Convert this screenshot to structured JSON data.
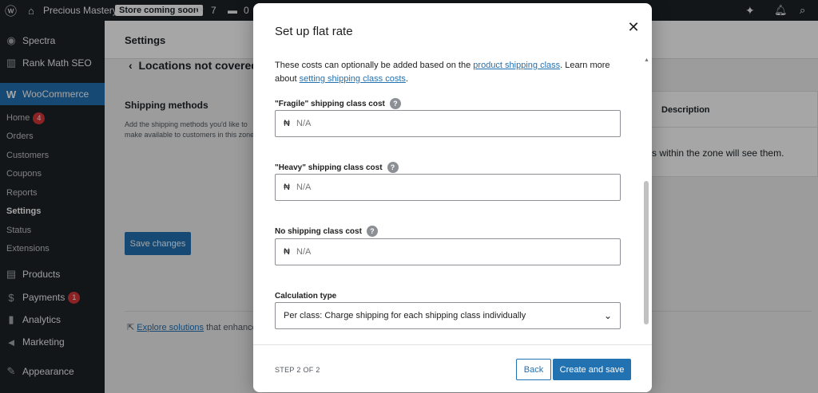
{
  "adminbar": {
    "site_name": "Precious Mastery",
    "store_badge": "Store coming soon",
    "updates_count": "7",
    "comments_count": "0"
  },
  "sidebar": {
    "items": [
      {
        "label": "Spectra",
        "icon": "spectra-icon"
      },
      {
        "label": "Rank Math SEO",
        "icon": "rank-math-icon"
      },
      {
        "label": "WooCommerce",
        "icon": "woocommerce-icon"
      },
      {
        "label": "Products",
        "icon": "products-icon"
      },
      {
        "label": "Payments",
        "icon": "payments-icon",
        "badge": "1"
      },
      {
        "label": "Analytics",
        "icon": "analytics-icon"
      },
      {
        "label": "Marketing",
        "icon": "marketing-icon"
      },
      {
        "label": "Appearance",
        "icon": "appearance-icon"
      }
    ],
    "woo_sub": [
      {
        "label": "Home",
        "badge": "4"
      },
      {
        "label": "Orders"
      },
      {
        "label": "Customers"
      },
      {
        "label": "Coupons"
      },
      {
        "label": "Reports"
      },
      {
        "label": "Settings"
      },
      {
        "label": "Status"
      },
      {
        "label": "Extensions"
      }
    ]
  },
  "background": {
    "page_title": "Settings",
    "back_label": "Locations not covered",
    "shipping_methods_heading": "Shipping methods",
    "shipping_methods_desc": "Add the shipping methods you'd like to make available to customers in this zone.",
    "save_changes": "Save changes",
    "description_header": "Description",
    "zone_text": "s within the zone will see them.",
    "explore_link": "Explore solutions",
    "explore_suffix": "that enhance"
  },
  "modal": {
    "title": "Set up flat rate",
    "intro_part1": "These costs can optionally be added based on the",
    "intro_link1": "product shipping class",
    "intro_part2": ". Learn more about",
    "intro_link2": "setting shipping class costs",
    "intro_part3": ".",
    "fields": [
      {
        "label": "\"Fragile\" shipping class cost",
        "currency": "₦",
        "placeholder": "N/A"
      },
      {
        "label": "\"Heavy\" shipping class cost",
        "currency": "₦",
        "placeholder": "N/A"
      },
      {
        "label": "No shipping class cost",
        "currency": "₦",
        "placeholder": "N/A"
      }
    ],
    "calc_label": "Calculation type",
    "calc_value": "Per class: Charge shipping for each shipping class individually",
    "step_label": "STEP 2 OF 2",
    "back_button": "Back",
    "save_button": "Create and save"
  },
  "colors": {
    "accent": "#2271b1",
    "admin_dark": "#1d2327",
    "badge_red": "#d63638"
  }
}
